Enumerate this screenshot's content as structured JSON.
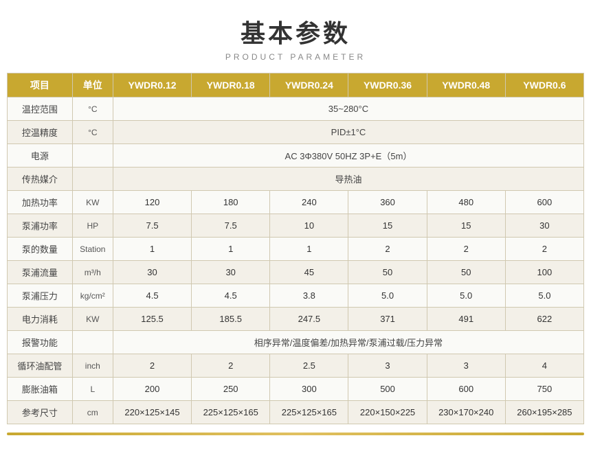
{
  "title": {
    "cn": "基本参数",
    "en": "PRODUCT PARAMETER"
  },
  "table": {
    "headers": [
      "项目",
      "单位",
      "YWDR0.12",
      "YWDR0.18",
      "YWDR0.24",
      "YWDR0.36",
      "YWDR0.48",
      "YWDR0.6"
    ],
    "rows": [
      {
        "label": "温控范围",
        "unit": "°C",
        "span": true,
        "spanValue": "35~280°C",
        "values": []
      },
      {
        "label": "控温精度",
        "unit": "°C",
        "span": true,
        "spanValue": "PID±1°C",
        "values": []
      },
      {
        "label": "电源",
        "unit": "",
        "span": true,
        "spanValue": "AC 3Φ380V 50HZ 3P+E（5m）",
        "values": []
      },
      {
        "label": "传热媒介",
        "unit": "",
        "span": true,
        "spanValue": "导热油",
        "values": []
      },
      {
        "label": "加热功率",
        "unit": "KW",
        "span": false,
        "spanValue": "",
        "values": [
          "120",
          "180",
          "240",
          "360",
          "480",
          "600"
        ]
      },
      {
        "label": "泵浦功率",
        "unit": "HP",
        "span": false,
        "spanValue": "",
        "values": [
          "7.5",
          "7.5",
          "10",
          "15",
          "15",
          "30"
        ]
      },
      {
        "label": "泵的数量",
        "unit": "Station",
        "span": false,
        "spanValue": "",
        "values": [
          "1",
          "1",
          "1",
          "2",
          "2",
          "2"
        ]
      },
      {
        "label": "泵浦流量",
        "unit": "m³/h",
        "span": false,
        "spanValue": "",
        "values": [
          "30",
          "30",
          "45",
          "50",
          "50",
          "100"
        ]
      },
      {
        "label": "泵浦压力",
        "unit": "kg/cm²",
        "span": false,
        "spanValue": "",
        "values": [
          "4.5",
          "4.5",
          "3.8",
          "5.0",
          "5.0",
          "5.0"
        ]
      },
      {
        "label": "电力消耗",
        "unit": "KW",
        "span": false,
        "spanValue": "",
        "values": [
          "125.5",
          "185.5",
          "247.5",
          "371",
          "491",
          "622"
        ]
      },
      {
        "label": "报警功能",
        "unit": "",
        "span": true,
        "spanValue": "相序异常/温度偏差/加热异常/泵浦过载/压力异常",
        "values": []
      },
      {
        "label": "循环油配管",
        "unit": "inch",
        "span": false,
        "spanValue": "",
        "values": [
          "2",
          "2",
          "2.5",
          "3",
          "3",
          "4"
        ]
      },
      {
        "label": "膨胀油箱",
        "unit": "L",
        "span": false,
        "spanValue": "",
        "values": [
          "200",
          "250",
          "300",
          "500",
          "600",
          "750"
        ]
      },
      {
        "label": "参考尺寸",
        "unit": "cm",
        "span": false,
        "spanValue": "",
        "values": [
          "220×125×145",
          "225×125×165",
          "225×125×165",
          "220×150×225",
          "230×170×240",
          "260×195×285"
        ]
      }
    ]
  }
}
